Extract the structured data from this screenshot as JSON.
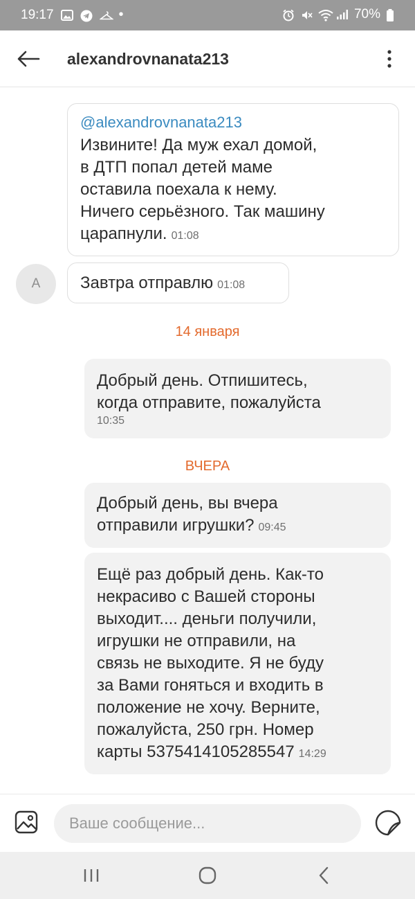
{
  "status_bar": {
    "time": "19:17",
    "battery": "70%",
    "left_icons": [
      "image-icon",
      "telegram-icon",
      "hanger-icon",
      "dot-icon"
    ],
    "right_icons": [
      "alarm-icon",
      "mute-icon",
      "wifi-icon",
      "signal-icon",
      "battery-icon"
    ]
  },
  "header": {
    "title": "alexandrovnanata213"
  },
  "messages": [
    {
      "direction": "in",
      "quote": "@alexandrovnanata213",
      "text_lines": [
        "Извините! Да муж ехал домой,",
        "в ДТП попал  детей маме",
        "оставила  поехала к нему.",
        "Ничего серьёзного.  Так машину"
      ],
      "last_line": "царапнули.",
      "time": "01:08"
    },
    {
      "direction": "in",
      "avatar": "A",
      "text_lines": [],
      "last_line": "Завтра отправлю",
      "time": "01:08"
    },
    {
      "direction": "out",
      "text_lines": [
        "Добрый день. Отпишитесь,",
        "когда отправите, пожалуйста"
      ],
      "last_line": "",
      "time": "10:35"
    },
    {
      "direction": "out",
      "text_lines": [
        "Добрый день, вы вчера"
      ],
      "last_line": "отправили игрушки?",
      "time": "09:45"
    },
    {
      "direction": "out",
      "text_lines": [
        "Ещё раз добрый день. Как-то",
        "некрасиво с Вашей стороны",
        "выходит.... деньги получили,",
        "игрушки не отправили, на",
        "связь не выходите. Я не буду",
        "за Вами гоняться и входить в",
        "положение не хочу. Верните,",
        "пожалуйста, 250 грн. Номер"
      ],
      "last_line": "карты 5375414105285547",
      "time": "14:29"
    }
  ],
  "date_separators": [
    "14 января",
    "ВЧЕРА"
  ],
  "input": {
    "placeholder": "Ваше сообщение..."
  },
  "colors": {
    "accent_orange": "#e36a2d",
    "quote_blue": "#3b8bc0",
    "outgoing_bubble": "#f2f2f2"
  }
}
